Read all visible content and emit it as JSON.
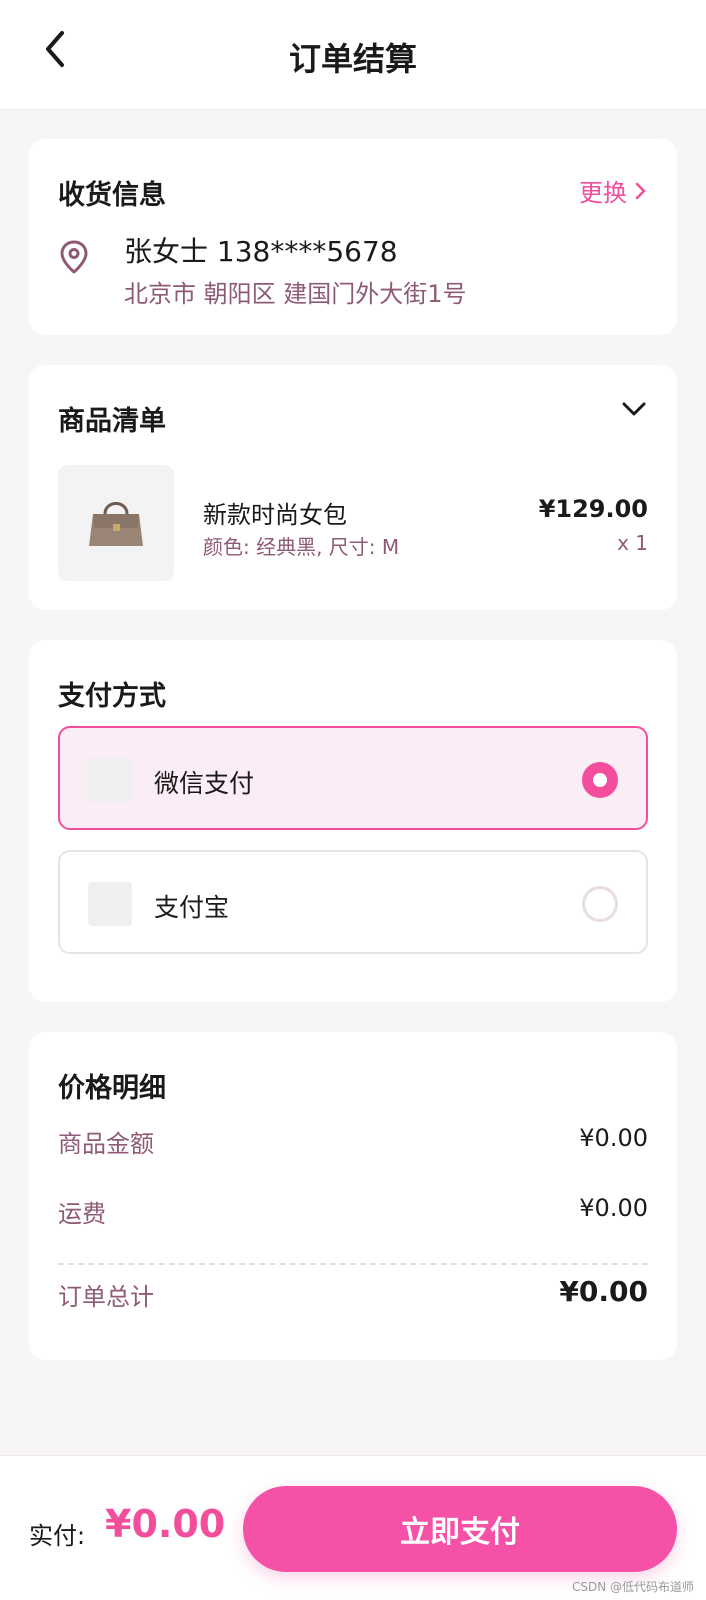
{
  "header": {
    "title": "订单结算"
  },
  "address": {
    "title": "收货信息",
    "change_label": "更换",
    "name_phone": "张女士 138****5678",
    "line": "北京市 朝阳区 建国门外大街1号"
  },
  "items": {
    "title": "商品清单",
    "list": [
      {
        "name": "新款时尚女包",
        "spec": "颜色: 经典黑, 尺寸: M",
        "price": "¥129.00",
        "qty": "x 1"
      }
    ]
  },
  "payment": {
    "title": "支付方式",
    "options": [
      {
        "label": "微信支付",
        "selected": true
      },
      {
        "label": "支付宝",
        "selected": false
      }
    ]
  },
  "price_detail": {
    "title": "价格明细",
    "goods_label": "商品金额",
    "goods_value": "¥0.00",
    "shipping_label": "运费",
    "shipping_value": "¥0.00",
    "total_label": "订单总计",
    "total_value": "¥0.00"
  },
  "bottom": {
    "pay_prefix": "实付:",
    "pay_total": "¥0.00",
    "pay_button": "立即支付"
  },
  "watermark": "CSDN @低代码布道师",
  "colors": {
    "accent": "#f24e9c",
    "muted_text": "#8f5a75",
    "background": "#f7f5f6"
  },
  "icons": [
    "back-arrow-icon",
    "chevron-right-icon",
    "location-pin-icon",
    "chevron-down-icon",
    "handbag-icon",
    "radio-checked-icon",
    "radio-unchecked-icon"
  ]
}
